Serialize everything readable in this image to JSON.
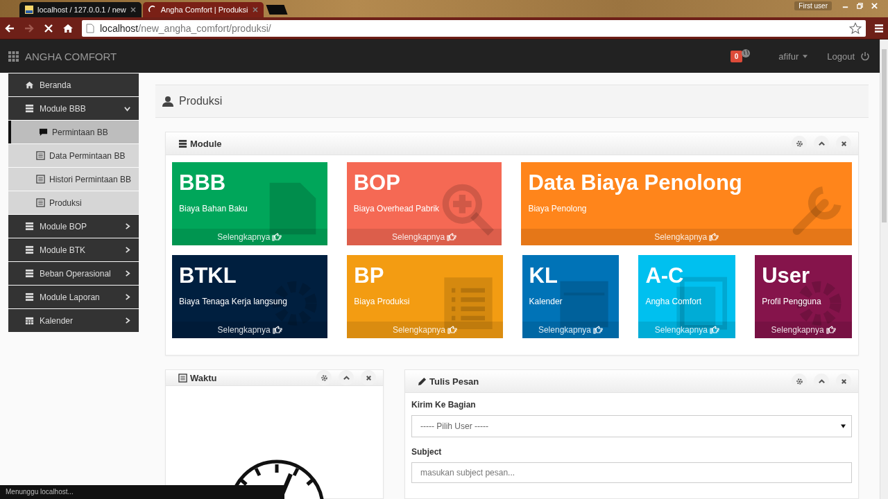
{
  "browser": {
    "tabs": [
      {
        "title": "localhost / 127.0.0.1 / new",
        "selected": false
      },
      {
        "title": "Angha Comfort | Produksi",
        "selected": true
      }
    ],
    "profile": "First user",
    "url_host": "localhost",
    "url_path": "/new_angha_comfort/produksi/"
  },
  "navbar": {
    "brand": "ANGHA COMFORT",
    "notifications": "0",
    "user": "afifur",
    "logout": "Logout"
  },
  "sidebar": {
    "items": [
      {
        "label": "Beranda",
        "kind": "link"
      },
      {
        "label": "Module BBB",
        "kind": "group",
        "expanded": true,
        "children": [
          {
            "label": "Permintaan BB",
            "selected": true
          },
          {
            "label": "Data Permintaan BB",
            "selected": false
          },
          {
            "label": "Histori Permintaan BB",
            "selected": false
          },
          {
            "label": "Produksi",
            "selected": false
          }
        ]
      },
      {
        "label": "Module BOP",
        "kind": "group",
        "expanded": false
      },
      {
        "label": "Module BTK",
        "kind": "group",
        "expanded": false
      },
      {
        "label": "Beban Operasional",
        "kind": "group",
        "expanded": false
      },
      {
        "label": "Module Laporan",
        "kind": "group",
        "expanded": false
      },
      {
        "label": "Kalender",
        "kind": "calendar",
        "expanded": false
      }
    ]
  },
  "page_title": "Produksi",
  "module_panel": {
    "title": "Module",
    "rows": [
      [
        {
          "title": "BBB",
          "subtitle": "Biaya Bahan Baku",
          "link": "Selengkapnya",
          "color": "#00a65a"
        },
        {
          "title": "BOP",
          "subtitle": "Biaya Overhead Pabrik",
          "link": "Selengkapnya",
          "color": "#f56954"
        },
        {
          "title": "Data Biaya Penolong",
          "subtitle": "Biaya Penolong",
          "link": "Selengkapnya",
          "color": "#ff851b"
        }
      ],
      [
        {
          "title": "BTKL",
          "subtitle": "Biaya Tenaga Kerja langsung",
          "link": "Selengkapnya",
          "color": "#001f3f"
        },
        {
          "title": "BP",
          "subtitle": "Biaya Produksi",
          "link": "Selengkapnya",
          "color": "#f39c12"
        },
        {
          "title": "KL",
          "subtitle": "Kalender",
          "link": "Selengkapnya",
          "color": "#0073b7"
        },
        {
          "title": "A-C",
          "subtitle": "Angha Comfort",
          "link": "Selengkapnya",
          "color": "#00c0ef"
        },
        {
          "title": "User",
          "subtitle": "Profil Pengguna",
          "link": "Selengkapnya",
          "color": "#85144b"
        }
      ]
    ]
  },
  "clock_panel": {
    "title": "Waktu"
  },
  "message_panel": {
    "title": "Tulis Pesan",
    "fields": [
      {
        "label": "Kirim Ke Bagian",
        "kind": "select",
        "placeholder": "----- Pilih User -----"
      },
      {
        "label": "Subject",
        "kind": "text",
        "placeholder": "masukan subject pesan..."
      }
    ]
  },
  "status_bar": "Menunggu localhost..."
}
